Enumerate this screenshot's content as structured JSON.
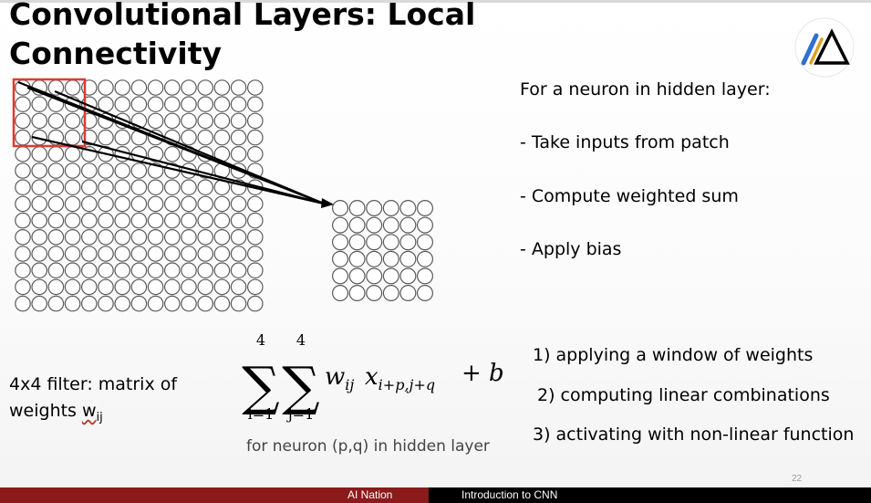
{
  "slide": {
    "title": "Convolutional Layers: Local Connectivity",
    "bullets": [
      "For a neuron in hidden layer:",
      "- Take inputs from patch",
      "- Compute weighted sum",
      "- Apply bias"
    ],
    "filter_note": {
      "line1": "4x4 filter: matrix of",
      "line2_prefix": "weights ",
      "line2_var": "w",
      "line2_sub": "ij"
    },
    "formula": {
      "sum1_upper": "4",
      "sum1_lower": "i=1",
      "sum2_upper": "4",
      "sum2_lower": "j=1",
      "w": "w",
      "w_sub": "ij",
      "x": "x",
      "x_sub": "i+p,j+q",
      "plus_b": "+ b"
    },
    "caption": "for neuron (p,q) in hidden layer",
    "steps": [
      "1) applying a window of weights",
      "2) computing linear combinations",
      "3) activating with non-linear function"
    ],
    "page_number": "22"
  },
  "diagram": {
    "input_grid": {
      "rows": 14,
      "cols": 15
    },
    "output_grid": {
      "rows": 6,
      "cols": 6
    },
    "patch": {
      "rows": 4,
      "cols": 4,
      "color": "#e03a2f"
    }
  },
  "footer": {
    "left_label": "AI Nation",
    "right_label": "Introduction to CNN",
    "left_color": "#8b1a1a",
    "right_color": "#000000"
  },
  "logo": {
    "icon": "ai-nation-logo-icon",
    "colors": [
      "#2f6fd1",
      "#e0a020",
      "#000000"
    ]
  }
}
